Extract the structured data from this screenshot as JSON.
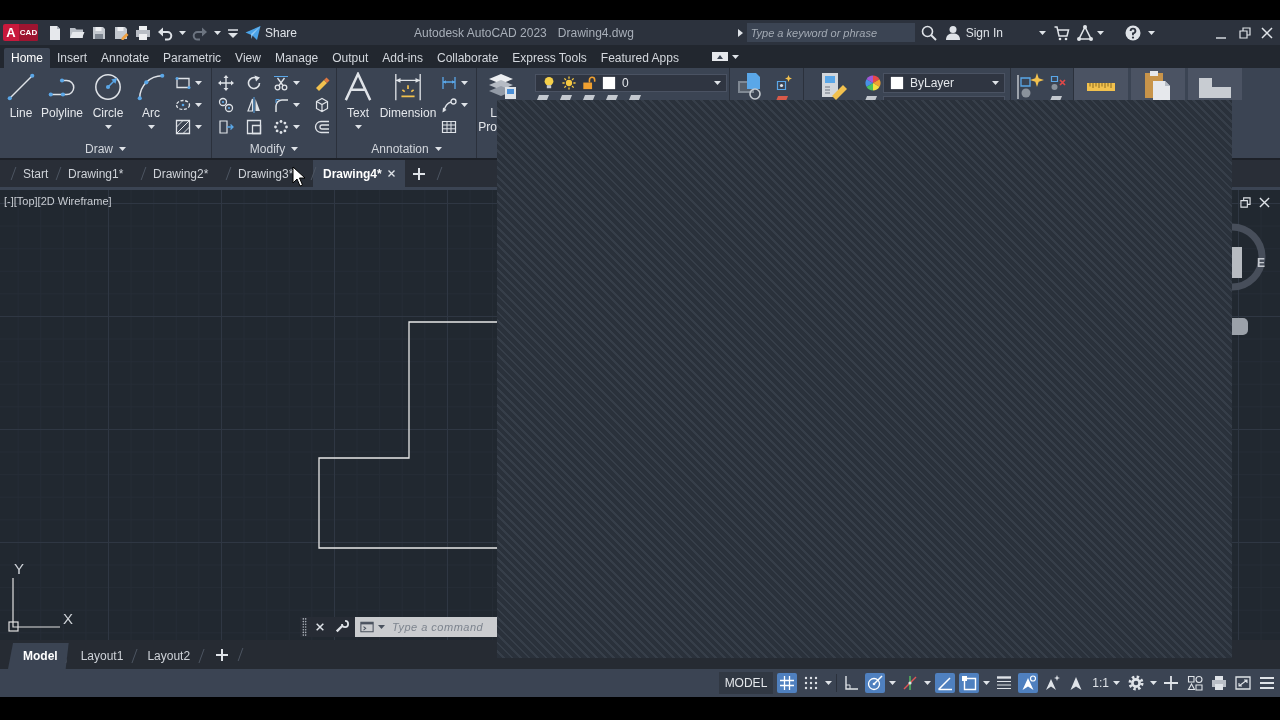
{
  "title_bar": {
    "app_badge": {
      "letter": "A",
      "label": "CAD"
    },
    "share": "Share",
    "title": "Autodesk AutoCAD 2023",
    "document": "Drawing4.dwg",
    "search": {
      "placeholder": "Type a keyword or phrase"
    },
    "sign_in": "Sign In"
  },
  "ribbon": {
    "tabs": [
      {
        "label": "Home",
        "selected": true
      },
      {
        "label": "Insert",
        "selected": false
      },
      {
        "label": "Annotate",
        "selected": false
      },
      {
        "label": "Parametric",
        "selected": false
      },
      {
        "label": "View",
        "selected": false
      },
      {
        "label": "Manage",
        "selected": false
      },
      {
        "label": "Output",
        "selected": false
      },
      {
        "label": "Add-ins",
        "selected": false
      },
      {
        "label": "Collaborate",
        "selected": false
      },
      {
        "label": "Express Tools",
        "selected": false
      },
      {
        "label": "Featured Apps",
        "selected": false
      }
    ],
    "draw": {
      "title": "Draw",
      "tools": [
        {
          "label": "Line",
          "dropdown": false
        },
        {
          "label": "Polyline",
          "dropdown": false
        },
        {
          "label": "Circle",
          "dropdown": true
        },
        {
          "label": "Arc",
          "dropdown": true
        }
      ]
    },
    "modify": {
      "title": "Modify"
    },
    "annotation": {
      "title": "Annotation",
      "tools": [
        {
          "label": "Text",
          "dropdown": true
        },
        {
          "label": "Dimension",
          "dropdown": false
        }
      ]
    },
    "layers": {
      "tool_label_lines": [
        "L",
        "Pro"
      ],
      "current_layer": "0"
    },
    "properties": {
      "dropdown_value": "ByLayer"
    }
  },
  "file_tabs": [
    {
      "label": "Start",
      "selected": false
    },
    {
      "label": "Drawing1*",
      "selected": false
    },
    {
      "label": "Drawing2*",
      "selected": false
    },
    {
      "label": "Drawing3*",
      "selected": false
    },
    {
      "label": "Drawing4*",
      "selected": true
    }
  ],
  "viewport": {
    "controls": "[-][Top][2D Wireframe]",
    "viewcube_face": "E",
    "ucs": {
      "y": "Y",
      "x": "X"
    }
  },
  "command_line": {
    "placeholder": "Type a command"
  },
  "layout_tabs": [
    {
      "label": "Model",
      "selected": true
    },
    {
      "label": "Layout1",
      "selected": false
    },
    {
      "label": "Layout2",
      "selected": false
    }
  ],
  "status_bar": {
    "space": "MODEL",
    "toggles": [
      {
        "on": true
      },
      {
        "on": false
      },
      {
        "on": false
      },
      {
        "on": true
      },
      {
        "on": false
      },
      {
        "on": true
      },
      {
        "on": true
      },
      {
        "on": false
      },
      {
        "on": true
      },
      {
        "on": false
      }
    ],
    "annotation_scale": "1:1"
  }
}
